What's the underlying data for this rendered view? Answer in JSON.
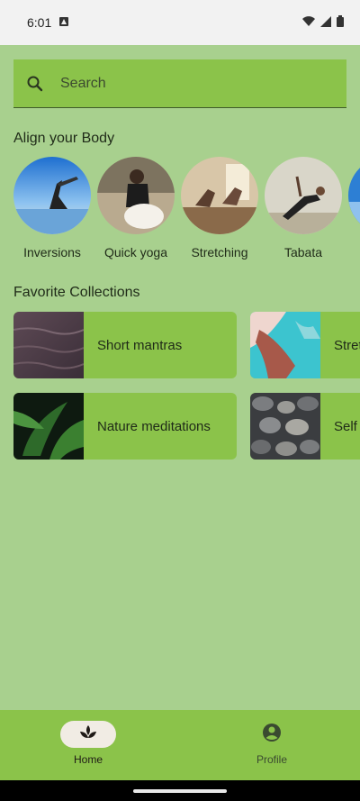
{
  "status_bar": {
    "time": "6:01"
  },
  "search": {
    "placeholder": "Search"
  },
  "align_body": {
    "title": "Align your Body",
    "items": [
      {
        "label": "Inversions"
      },
      {
        "label": "Quick yoga"
      },
      {
        "label": "Stretching"
      },
      {
        "label": "Tabata"
      },
      {
        "label": ""
      }
    ]
  },
  "favorites": {
    "title": "Favorite Collections",
    "items": [
      {
        "label": "Short mantras"
      },
      {
        "label": "Stretching"
      },
      {
        "label": "Nature meditations"
      },
      {
        "label": "Self massage"
      }
    ]
  },
  "bottom_nav": {
    "home_label": "Home",
    "profile_label": "Profile"
  },
  "colors": {
    "background": "#a8d08e",
    "surface": "#8bc34a",
    "nav_selected_pill": "#f1ece4"
  }
}
